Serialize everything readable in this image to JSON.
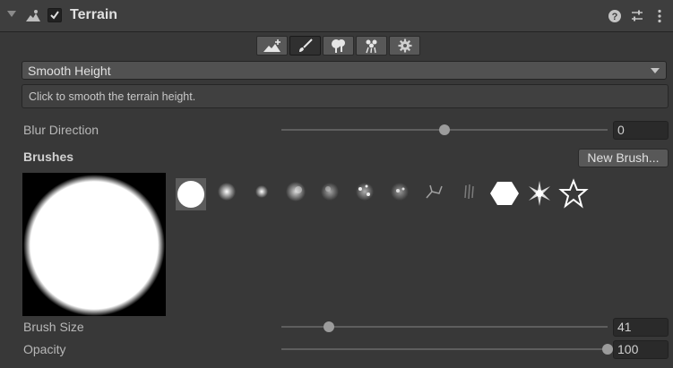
{
  "component": {
    "title": "Terrain",
    "enabled": true
  },
  "toolbar": {
    "tools": [
      {
        "name": "raise-terrain-tool"
      },
      {
        "name": "paint-terrain-tool",
        "active": true
      },
      {
        "name": "paint-trees-tool"
      },
      {
        "name": "paint-details-tool"
      },
      {
        "name": "terrain-settings-tool"
      }
    ]
  },
  "tool_select": {
    "value": "Smooth Height"
  },
  "help_text": "Click to smooth the terrain height.",
  "blur_direction": {
    "label": "Blur Direction",
    "value": "0",
    "slider_fraction": 0.5
  },
  "brushes": {
    "label": "Brushes",
    "new_button": "New Brush...",
    "selected_index": 0,
    "items": [
      "hard-round",
      "soft-round",
      "small-soft",
      "cloudy",
      "cloudy-2",
      "spotted",
      "spotted-2",
      "veins",
      "streaks",
      "hexagon",
      "star-burst",
      "star-outline"
    ]
  },
  "brush_size": {
    "label": "Brush Size",
    "value": "41",
    "slider_fraction": 0.145
  },
  "opacity": {
    "label": "Opacity",
    "value": "100",
    "slider_fraction": 1.0
  }
}
